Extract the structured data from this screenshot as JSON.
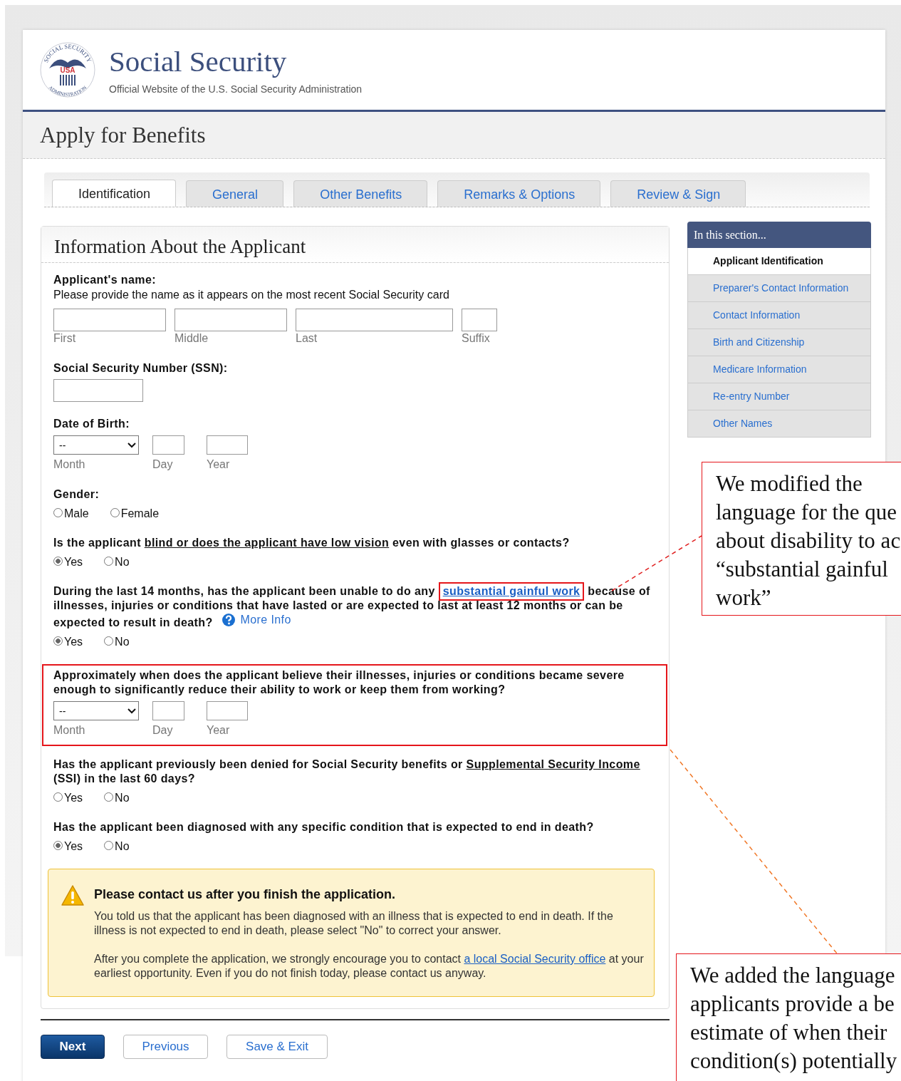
{
  "header": {
    "logo": {
      "ring_top": "SOCIAL SECURITY",
      "ring_bottom": "ADMINISTRATION",
      "center": "USA"
    },
    "title": "Social Security",
    "subtitle": "Official Website of the U.S. Social Security Administration"
  },
  "page_title": "Apply for Benefits",
  "tabs": [
    {
      "label": "Identification",
      "selected": true
    },
    {
      "label": "General",
      "selected": false
    },
    {
      "label": "Other Benefits",
      "selected": false
    },
    {
      "label": "Remarks & Options",
      "selected": false
    },
    {
      "label": "Review & Sign",
      "selected": false
    }
  ],
  "section": {
    "title": "Information About the Applicant",
    "fields": [
      {
        "kind": "name",
        "label": "Applicant's name:",
        "help": "Please provide the name as it appears on the most recent Social Security card",
        "inputs": [
          {
            "caption": "First"
          },
          {
            "caption": "Middle"
          },
          {
            "caption": "Last"
          },
          {
            "caption": "Suffix"
          }
        ]
      },
      {
        "kind": "text",
        "label": "Social Security Number (SSN):"
      },
      {
        "kind": "date",
        "label": "Date of Birth:",
        "select_value": "--",
        "captions": [
          "Month",
          "Day",
          "Year"
        ]
      },
      {
        "kind": "radio",
        "label_parts": [
          {
            "kind": "plain",
            "text": "Gender:"
          }
        ],
        "options": [
          {
            "label": "Male",
            "selected": false
          },
          {
            "label": "Female",
            "selected": false
          }
        ]
      },
      {
        "kind": "radio",
        "label_parts": [
          {
            "kind": "plain",
            "text": "Is the applicant "
          },
          {
            "kind": "term",
            "text": "blind or does the applicant have low vision"
          },
          {
            "kind": "plain",
            "text": " even with glasses or contacts?"
          }
        ],
        "options": [
          {
            "label": "Yes",
            "selected": true
          },
          {
            "label": "No",
            "selected": false
          }
        ]
      },
      {
        "kind": "radio",
        "label_parts": [
          {
            "kind": "plain",
            "text": "During the last 14 months, has the applicant been unable to do any "
          },
          {
            "kind": "link",
            "text": "substantial gainful work",
            "highlighted": true
          },
          {
            "kind": "plain",
            "text": " because of illnesses, injuries or conditions that have lasted or are expected to last at least 12 months or can be expected to result in death? "
          }
        ],
        "help_link": "More Info",
        "options": [
          {
            "label": "Yes",
            "selected": true
          },
          {
            "label": "No",
            "selected": false
          }
        ]
      },
      {
        "kind": "date",
        "label": "Approximately when does the applicant believe their illnesses, injuries or conditions became severe enough to significantly reduce their ability to work or keep them from working?",
        "select_value": "--",
        "captions": [
          "Month",
          "Day",
          "Year"
        ],
        "highlighted": true
      },
      {
        "kind": "radio",
        "label_parts": [
          {
            "kind": "plain",
            "text": "Has the applicant previously been denied for Social Security benefits or "
          },
          {
            "kind": "term",
            "text": "Supplemental Security Income"
          },
          {
            "kind": "plain",
            "text": " (SSI) in the last 60 days?"
          }
        ],
        "options": [
          {
            "label": "Yes",
            "selected": false
          },
          {
            "label": "No",
            "selected": false
          }
        ]
      },
      {
        "kind": "radio",
        "label_parts": [
          {
            "kind": "plain",
            "text": "Has the applicant been diagnosed with any specific condition that is expected to end in death?"
          }
        ],
        "options": [
          {
            "label": "Yes",
            "selected": true
          },
          {
            "label": "No",
            "selected": false
          }
        ]
      }
    ],
    "alert": {
      "title": "Please contact us after you finish the application.",
      "paragraphs": [
        [
          {
            "kind": "plain",
            "text": "You told us that the applicant has been diagnosed with an illness that is expected to end in death. If the illness is not expected to end in death, please select \"No\" to correct your answer."
          }
        ],
        [
          {
            "kind": "plain",
            "text": "After you complete the application, we strongly encourage you to contact "
          },
          {
            "kind": "link",
            "text": "a local Social Security office"
          },
          {
            "kind": "plain",
            "text": " at your earliest opportunity. Even if you do not finish today, please contact us anyway."
          }
        ]
      ]
    }
  },
  "sidebar": {
    "heading": "In this section...",
    "items": [
      {
        "label": "Applicant Identification",
        "selected": true
      },
      {
        "label": "Preparer's Contact Information",
        "selected": false
      },
      {
        "label": "Contact Information",
        "selected": false
      },
      {
        "label": "Birth and Citizenship",
        "selected": false
      },
      {
        "label": "Medicare Information",
        "selected": false
      },
      {
        "label": "Re-entry Number",
        "selected": false
      },
      {
        "label": "Other Names",
        "selected": false
      }
    ]
  },
  "buttons": [
    {
      "label": "Next",
      "kind": "primary"
    },
    {
      "label": "Previous",
      "kind": "secondary"
    },
    {
      "label": "Save & Exit",
      "kind": "secondary"
    }
  ],
  "annotations": [
    {
      "lines": [
        "We modified the",
        "language for the que",
        "about disability to ac",
        "“substantial gainful",
        "work”"
      ]
    },
    {
      "lines": [
        "We added the language",
        "applicants provide a be",
        "estimate of when their",
        "condition(s) potentially"
      ]
    }
  ]
}
